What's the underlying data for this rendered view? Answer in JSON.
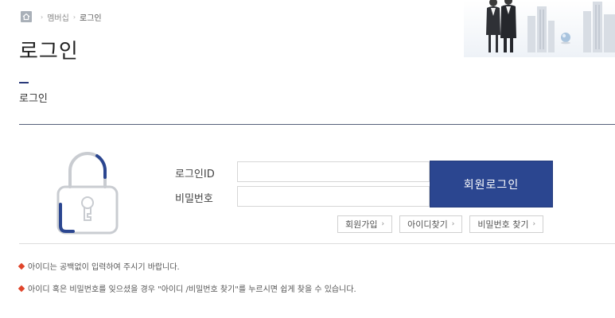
{
  "breadcrumb": {
    "items": [
      "멤버십",
      "로그인"
    ],
    "separator": "›"
  },
  "page_title": "로그인",
  "section_title": "로그인",
  "form": {
    "id_label": "로그인ID",
    "password_label": "비밀번호",
    "id_value": "",
    "password_value": "",
    "login_button": "회원로그인"
  },
  "links": [
    {
      "label": "회원가입",
      "chevron": "›"
    },
    {
      "label": "아이디찾기",
      "chevron": "›"
    },
    {
      "label": "비밀번호 찾기",
      "chevron": "›"
    }
  ],
  "notices": [
    "아이디는 공백없이 입력하여 주시기 바랍니다.",
    "아이디 혹은 비밀번호를 잊으셨을 경우 \"아이디 /비밀번호 찾기\"를 누르시면 쉽게 찾을 수 있습니다."
  ],
  "colors": {
    "primary": "#2b4690",
    "accent": "#e0452b",
    "lock_blue": "#2b4690",
    "lock_gray": "#c9ccd1"
  },
  "icons": {
    "home": "home-icon",
    "lock": "lock-icon",
    "notice_bullet": "diamond-icon"
  }
}
